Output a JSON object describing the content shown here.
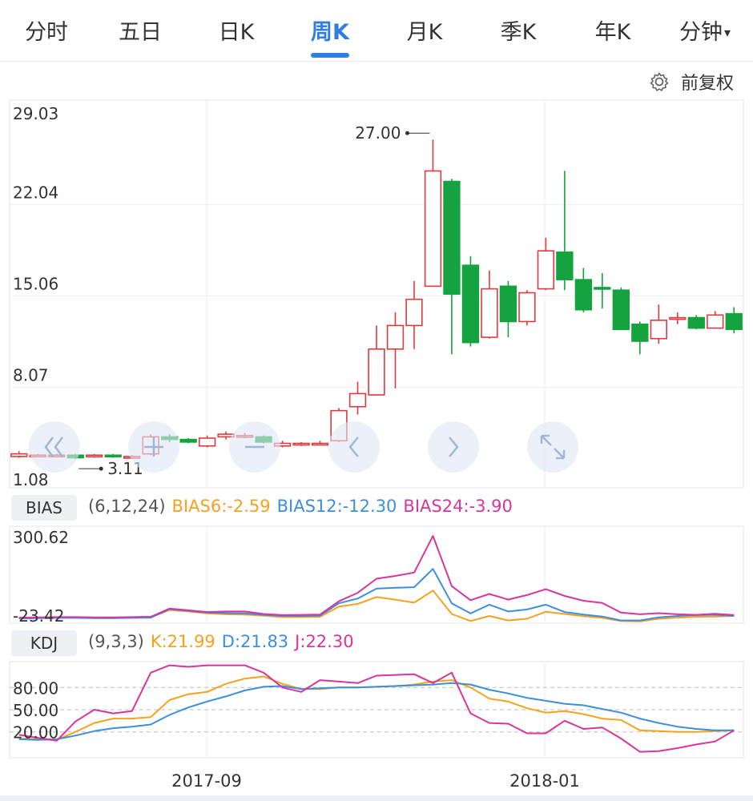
{
  "tabs": [
    {
      "label": "分时",
      "active": false
    },
    {
      "label": "五日",
      "active": false
    },
    {
      "label": "日K",
      "active": false
    },
    {
      "label": "周K",
      "active": true
    },
    {
      "label": "月K",
      "active": false
    },
    {
      "label": "季K",
      "active": false
    },
    {
      "label": "年K",
      "active": false
    },
    {
      "label": "分钟",
      "active": false
    }
  ],
  "tab_dropdown_caret": "▾",
  "adjust_label": "前复权",
  "colors": {
    "up": "#e0393e",
    "down": "#14a33f",
    "bias6": "#f7a21e",
    "bias12": "#3c8fde",
    "bias24": "#d8359e",
    "accent": "#2f7fe0"
  },
  "bias": {
    "tag": "BIAS",
    "params": "(6,12,24)",
    "b6": "BIAS6:-2.59",
    "b12": "BIAS12:-12.30",
    "b24": "BIAS24:-3.90"
  },
  "kdj": {
    "tag": "KDJ",
    "params": "(9,3,3)",
    "k": "K:21.99",
    "d": "D:21.83",
    "j": "J:22.30"
  },
  "chart_data": [
    {
      "type": "candlestick",
      "y_ticks": [
        "29.03",
        "22.04",
        "15.06",
        "8.07",
        "1.08"
      ],
      "ylim": [
        1.08,
        29.03
      ],
      "x_ticks": [
        "2017-09",
        "2018-01"
      ],
      "max_label": "27.00",
      "min_label": "3.11",
      "candles": [
        [
          2.8,
          3.0,
          3.2,
          2.7
        ],
        [
          2.9,
          2.9,
          3.0,
          2.8
        ],
        [
          2.9,
          2.9,
          3.0,
          2.8
        ],
        [
          2.9,
          2.7,
          3.0,
          2.6
        ],
        [
          2.8,
          2.9,
          3.0,
          2.7
        ],
        [
          2.9,
          2.8,
          3.0,
          2.7
        ],
        [
          2.8,
          2.8,
          2.9,
          2.7
        ],
        [
          3.0,
          4.3,
          4.5,
          2.9
        ],
        [
          4.3,
          4.1,
          4.5,
          3.9
        ],
        [
          4.1,
          3.9,
          4.2,
          3.8
        ],
        [
          3.6,
          4.2,
          4.4,
          3.5
        ],
        [
          4.3,
          4.5,
          4.7,
          4.1
        ],
        [
          4.4,
          4.4,
          4.6,
          4.2
        ],
        [
          4.3,
          3.9,
          4.4,
          3.8
        ],
        [
          3.6,
          3.8,
          4.0,
          3.5
        ],
        [
          3.7,
          3.8,
          3.9,
          3.6
        ],
        [
          3.8,
          3.8,
          4.0,
          3.7
        ],
        [
          4.0,
          6.3,
          6.5,
          3.9
        ],
        [
          6.6,
          7.6,
          8.5,
          6.0
        ],
        [
          7.5,
          11.0,
          12.8,
          7.5
        ],
        [
          11.0,
          12.8,
          13.8,
          8.0
        ],
        [
          12.8,
          14.8,
          16.2,
          11.0
        ],
        [
          15.8,
          24.6,
          27.0,
          15.8
        ],
        [
          23.8,
          15.2,
          24.0,
          10.6
        ],
        [
          17.4,
          11.5,
          18.1,
          11.2
        ],
        [
          11.9,
          15.6,
          17.0,
          11.8
        ],
        [
          15.8,
          13.1,
          16.2,
          11.9
        ],
        [
          13.1,
          15.3,
          15.5,
          12.8
        ],
        [
          15.6,
          18.5,
          19.5,
          15.5
        ],
        [
          18.4,
          16.3,
          24.6,
          15.5
        ],
        [
          16.3,
          14.0,
          17.2,
          13.8
        ],
        [
          15.7,
          15.6,
          16.8,
          14.1
        ],
        [
          15.5,
          12.5,
          15.7,
          12.5
        ],
        [
          12.9,
          11.6,
          13.1,
          10.6
        ],
        [
          11.8,
          13.2,
          14.4,
          11.4
        ],
        [
          13.4,
          13.4,
          13.8,
          12.9
        ],
        [
          13.4,
          12.6,
          13.6,
          12.5
        ],
        [
          12.6,
          13.6,
          13.9,
          12.6
        ],
        [
          13.7,
          12.5,
          14.2,
          12.2
        ]
      ]
    },
    {
      "type": "line",
      "name": "BIAS",
      "y_ticks": [
        "300.62",
        "-23.42"
      ],
      "ylim": [
        -23.42,
        300.62
      ],
      "series": [
        {
          "name": "BIAS6",
          "values": [
            -20,
            -19,
            -18,
            -18,
            -19,
            -19,
            -18,
            -17,
            9,
            4,
            -3,
            -6,
            -7,
            -11,
            -16,
            -16,
            -15,
            21,
            31,
            55,
            46,
            35,
            78,
            -5,
            -30,
            -12,
            -28,
            -22,
            3,
            -5,
            -13,
            -19,
            -30,
            -31,
            -22,
            -18,
            -15,
            -14,
            -12
          ]
        },
        {
          "name": "BIAS12",
          "values": [
            -21,
            -20,
            -19,
            -19,
            -20,
            -20,
            -19,
            -18,
            12,
            6,
            0,
            -2,
            -3,
            -8,
            -12,
            -12,
            -11,
            33,
            50,
            85,
            88,
            90,
            155,
            33,
            -3,
            28,
            4,
            11,
            28,
            2,
            -7,
            -14,
            -28,
            -28,
            -17,
            -12,
            -9,
            -8,
            -12
          ]
        },
        {
          "name": "BIAS24",
          "values": [
            -18,
            -17,
            -16,
            -16,
            -17,
            -17,
            -16,
            -15,
            14,
            8,
            2,
            4,
            4,
            -5,
            -9,
            -8,
            -7,
            40,
            70,
            120,
            130,
            142,
            272,
            94,
            44,
            66,
            46,
            62,
            83,
            59,
            42,
            34,
            0,
            -6,
            -2,
            -6,
            -8,
            -4,
            -9
          ]
        }
      ]
    },
    {
      "type": "line",
      "name": "KDJ",
      "y_ticks": [
        "80.00",
        "50.00",
        "20.00"
      ],
      "ylim": [
        -15,
        115
      ],
      "grid_y": [
        80,
        50,
        20
      ],
      "series": [
        {
          "name": "K",
          "values": [
            11,
            10,
            9,
            20,
            32,
            38,
            38,
            40,
            63,
            71,
            74,
            85,
            92,
            95,
            85,
            78,
            78,
            80,
            80,
            81,
            82,
            84,
            88,
            90,
            80,
            65,
            61,
            52,
            46,
            48,
            44,
            38,
            36,
            22,
            21,
            20,
            20,
            21,
            22
          ]
        },
        {
          "name": "D",
          "values": [
            10,
            9,
            10,
            15,
            21,
            25,
            27,
            30,
            43,
            53,
            61,
            68,
            76,
            81,
            82,
            78,
            79,
            80,
            80,
            81,
            82,
            83,
            84,
            86,
            84,
            77,
            72,
            66,
            62,
            58,
            56,
            51,
            46,
            38,
            32,
            27,
            24,
            22,
            22
          ]
        },
        {
          "name": "J",
          "values": [
            16,
            12,
            8,
            34,
            50,
            45,
            48,
            100,
            110,
            108,
            110,
            110,
            110,
            100,
            80,
            74,
            90,
            88,
            86,
            96,
            97,
            98,
            86,
            100,
            45,
            32,
            31,
            18,
            18,
            35,
            24,
            26,
            11,
            -7,
            -6,
            -2,
            3,
            7,
            22
          ]
        }
      ]
    }
  ]
}
